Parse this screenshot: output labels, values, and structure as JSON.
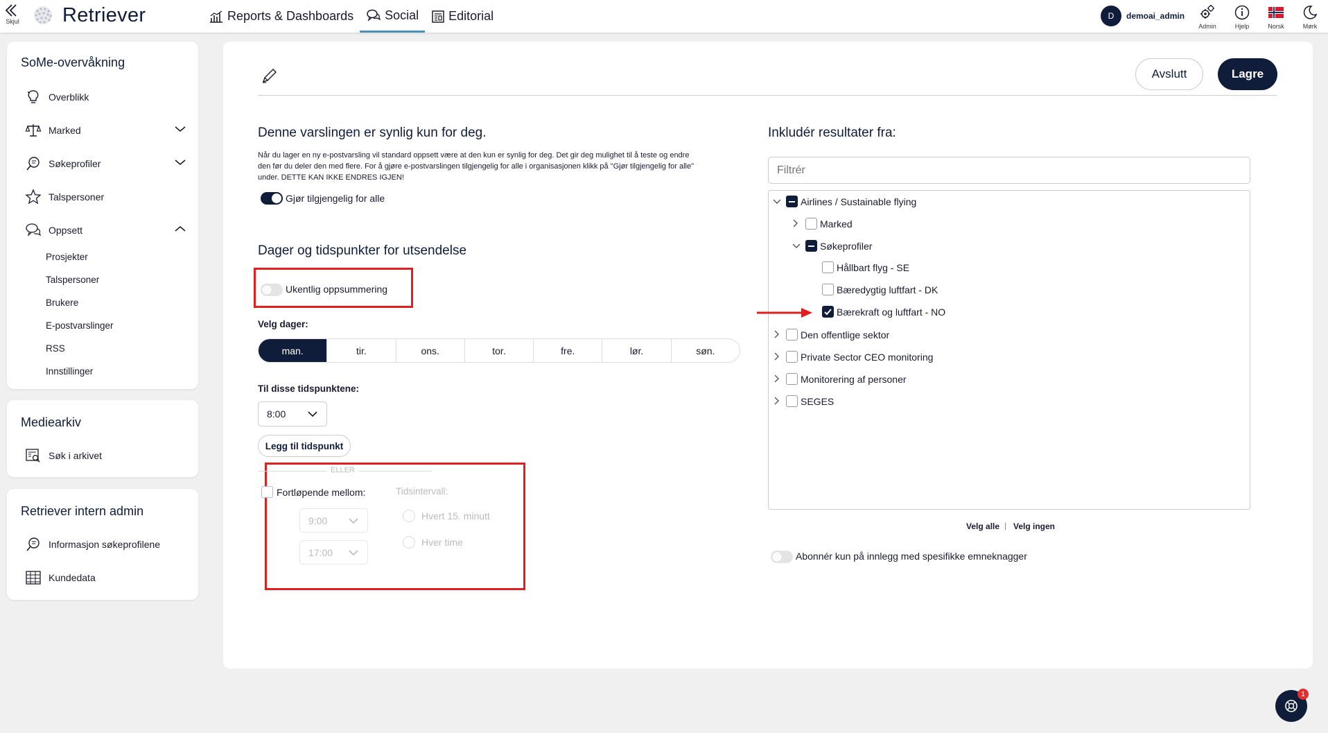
{
  "topbar": {
    "hide_label": "Skjul",
    "brand": "Retriever",
    "nav": [
      {
        "label": "Reports & Dashboards",
        "icon": "bar-chart-icon",
        "active": false
      },
      {
        "label": "Social",
        "icon": "chat-bubbles-icon",
        "active": true
      },
      {
        "label": "Editorial",
        "icon": "newspaper-icon",
        "active": false
      }
    ],
    "user": {
      "initial": "D",
      "name": "demoai_admin"
    },
    "icons": [
      {
        "label": "Admin",
        "icon": "gears-icon"
      },
      {
        "label": "Hjelp",
        "icon": "info-icon"
      },
      {
        "label": "Norsk",
        "icon": "norway-flag-icon"
      },
      {
        "label": "Mørk",
        "icon": "moon-icon"
      }
    ]
  },
  "sidebar": {
    "section1": {
      "title": "SoMe-overvåkning",
      "items": [
        {
          "label": "Overblikk",
          "icon": "lightbulb-icon"
        },
        {
          "label": "Marked",
          "icon": "scale-icon",
          "expanded": false
        },
        {
          "label": "Søkeprofiler",
          "icon": "search-bubble-icon",
          "expanded": false
        },
        {
          "label": "Talspersoner",
          "icon": "star-icon"
        },
        {
          "label": "Oppsett",
          "icon": "chat-bubbles-icon",
          "expanded": true
        }
      ],
      "subitems": [
        "Prosjekter",
        "Talspersoner",
        "Brukere",
        "E-postvarslinger",
        "RSS",
        "Innstillinger"
      ]
    },
    "section2": {
      "title": "Mediearkiv",
      "items": [
        {
          "label": "Søk i arkivet",
          "icon": "archive-search-icon"
        }
      ]
    },
    "section3": {
      "title": "Retriever intern admin",
      "items": [
        {
          "label": "Informasjon søkeprofilene",
          "icon": "search-bubble-icon"
        },
        {
          "label": "Kundedata",
          "icon": "table-icon"
        }
      ]
    }
  },
  "main": {
    "buttons": {
      "exit": "Avslutt",
      "save": "Lagre"
    },
    "visibility": {
      "heading": "Denne varslingen er synlig kun for deg.",
      "desc": [
        "Når du lager en ny e-postvarsling vil standard oppsett være at den kun er synlig for deg. Det gir deg mulighet til å teste og endre",
        "den før du deler den med flere. For å gjøre e-postvarslingen tilgjengelig for alle i organisasjonen klikk på \"Gjør tilgjengelig for alle\"",
        "under. DETTE KAN IKKE ENDRES IGJEN!"
      ],
      "toggle_label": "Gjør tilgjengelig for alle",
      "toggle_on": true
    },
    "schedule": {
      "heading": "Dager og tidspunkter for utsendelse",
      "weekly_label": "Ukentlig oppsummering",
      "weekly_on": false,
      "days_label": "Velg dager:",
      "days": [
        {
          "label": "man.",
          "selected": true
        },
        {
          "label": "tir.",
          "selected": false
        },
        {
          "label": "ons.",
          "selected": false
        },
        {
          "label": "tor.",
          "selected": false
        },
        {
          "label": "fre.",
          "selected": false
        },
        {
          "label": "lør.",
          "selected": false
        },
        {
          "label": "søn.",
          "selected": false
        }
      ],
      "times_label": "Til disse tidspunktene:",
      "time_value": "8:00",
      "add_time": "Legg til tidspunkt",
      "or_label": "ELLER",
      "continuous_label": "Fortløpende mellom:",
      "from_time": "9:00",
      "to_time": "17:00",
      "interval_label": "Tidsintervall:",
      "interval_options": [
        "Hvert 15. minutt",
        "Hver time"
      ]
    },
    "include": {
      "heading": "Inkludér resultater fra:",
      "filter_placeholder": "Filtrér",
      "tree": [
        {
          "label": "Airlines / Sustainable flying",
          "state": "partial",
          "level": 0,
          "expanded": true
        },
        {
          "label": "Marked",
          "state": "unchecked",
          "level": 1,
          "expanded": false
        },
        {
          "label": "Søkeprofiler",
          "state": "partial",
          "level": 1,
          "expanded": true
        },
        {
          "label": "Hållbart flyg - SE",
          "state": "unchecked",
          "level": 2
        },
        {
          "label": "Bæredygtig luftfart - DK",
          "state": "unchecked",
          "level": 2
        },
        {
          "label": "Bærekraft og luftfart - NO",
          "state": "checked",
          "level": 2
        },
        {
          "label": "Den offentlige sektor",
          "state": "unchecked",
          "level": 0,
          "expanded": false
        },
        {
          "label": "Private Sector CEO monitoring",
          "state": "unchecked",
          "level": 0,
          "expanded": false
        },
        {
          "label": "Monitorering af personer",
          "state": "unchecked",
          "level": 0,
          "expanded": false
        },
        {
          "label": "SEGES",
          "state": "unchecked",
          "level": 0,
          "expanded": false
        }
      ],
      "select_all": "Velg alle",
      "separator": "|",
      "select_none": "Velg ingen",
      "subscribe_label": "Abonnér kun på innlegg med spesifikke emneknagger",
      "subscribe_on": false
    },
    "help_badge": "1"
  }
}
